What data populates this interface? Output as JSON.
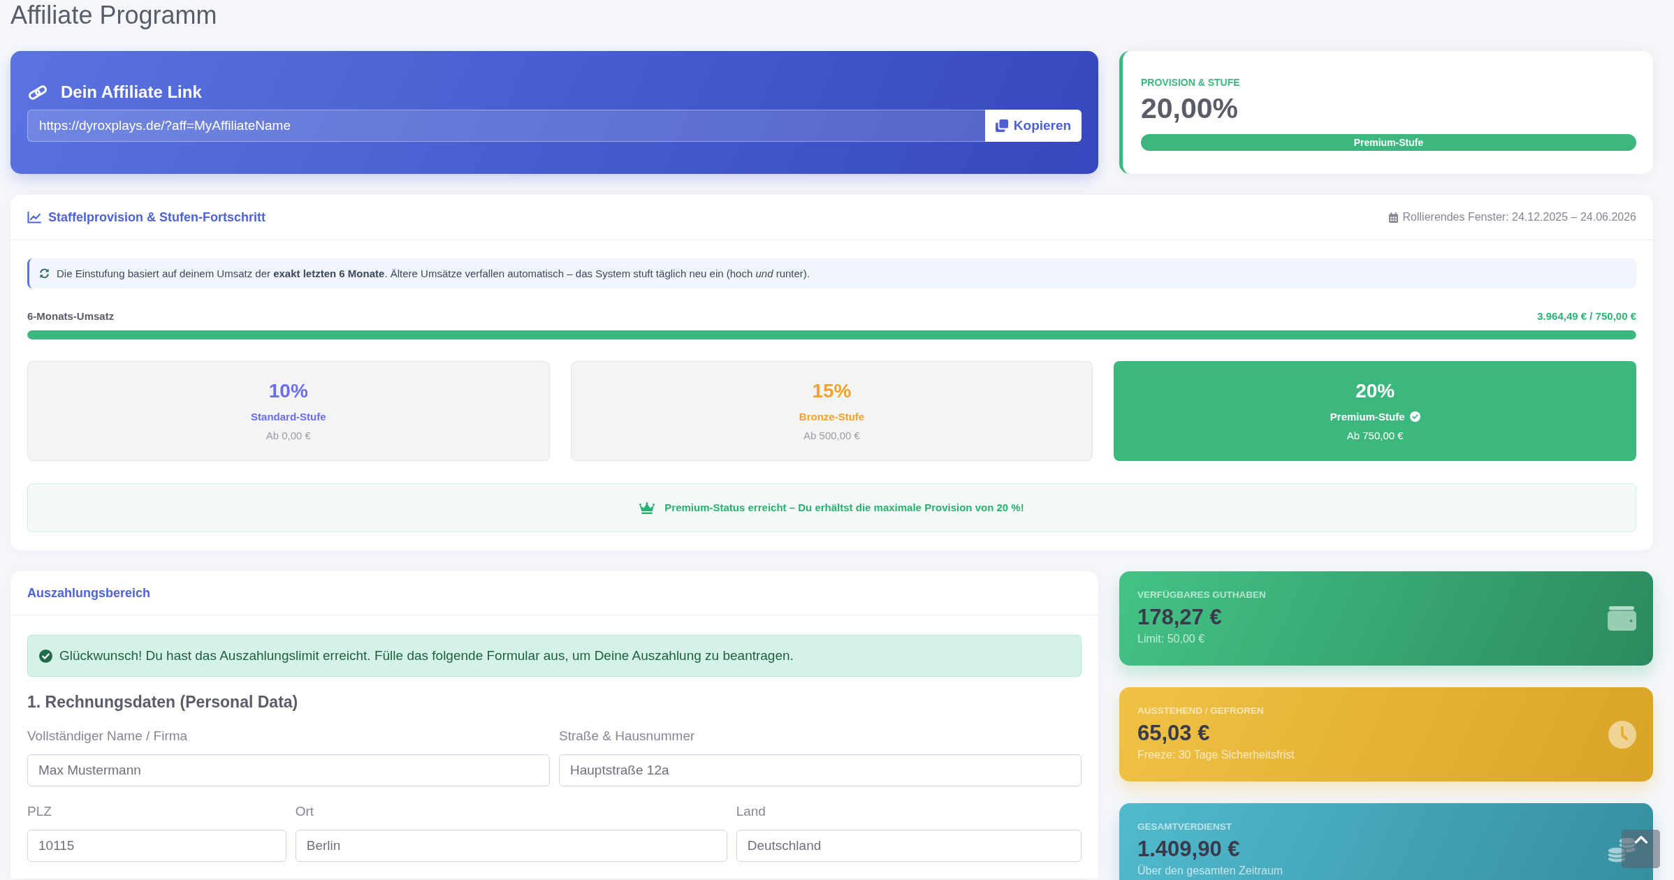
{
  "page_title": "Affiliate Programm",
  "affiliate_link": {
    "title": "Dein Affiliate Link",
    "url": "https://dyroxplays.de/?aff=MyAffiliateName",
    "copy_button": "Kopieren"
  },
  "provision": {
    "label": "PROVISION & STUFE",
    "rate": "20,00%",
    "tier_badge": "Premium-Stufe"
  },
  "tier_progress": {
    "title": "Staffelprovision & Stufen-Fortschritt",
    "window": "Rollierendes Fenster: 24.12.2025 – 24.06.2026",
    "info": "Die Einstufung basiert auf deinem Umsatz der **exakt letzten 6 Monate**. Ältere Umsätze verfallen automatisch – das System stuft täglich neu ein (hoch *und* runter).",
    "revenue": {
      "label": "6-Monats-Umsatz",
      "reading": "3.964,49 € / 750,00 €",
      "level": 1
    },
    "tiers": [
      {
        "percent": "10%",
        "name": "Standard-Stufe",
        "threshold": "Ab 0,00 €",
        "color": "#6b6ee8",
        "selected": false
      },
      {
        "percent": "15%",
        "name": "Bronze-Stufe",
        "threshold": "Ab 500,00 €",
        "color": "#f0a32a",
        "selected": false
      },
      {
        "percent": "20%",
        "name": "Premium-Stufe",
        "threshold": "Ab 750,00 €",
        "color": "#3cb87f",
        "selected": true
      }
    ],
    "notice": "Premium-Status erreicht – Du erhältst die maximale Provision von 20 %!"
  },
  "payout": {
    "title": "Auszahlungsbereich",
    "alert": "Glückwunsch! Du hast das Auszahlungslimit erreicht. Fülle das folgende Formular aus, um Deine Auszahlung zu beantragen.",
    "section_title": "1. Rechnungsdaten (Personal Data)",
    "rows": [
      {
        "fields": [
          {
            "label": "Vollständiger Name / Firma",
            "value": "Max Mustermann"
          },
          {
            "label": "Straße & Hausnummer",
            "value": "Hauptstraße 12a"
          }
        ]
      },
      {
        "fields": [
          {
            "label": "PLZ",
            "value": "10115"
          },
          {
            "label": "Ort",
            "value": "Berlin"
          },
          {
            "label": "Land",
            "value": "Deutschland"
          }
        ]
      }
    ]
  },
  "stats": [
    {
      "kind": "available",
      "label": "VERFÜGBARES GUTHABEN",
      "value": "178,27 €",
      "note": "Limit: 50,00 €"
    },
    {
      "kind": "pending",
      "label": "AUSSTEHEND / GEFROREN",
      "value": "65,03 €",
      "note": "Freeze: 30 Tage Sicherheitsfrist"
    },
    {
      "kind": "total",
      "label": "GESAMTVERDIENST",
      "value": "1.409,90 €",
      "note": "Über den gesamten Zeitraum"
    }
  ]
}
